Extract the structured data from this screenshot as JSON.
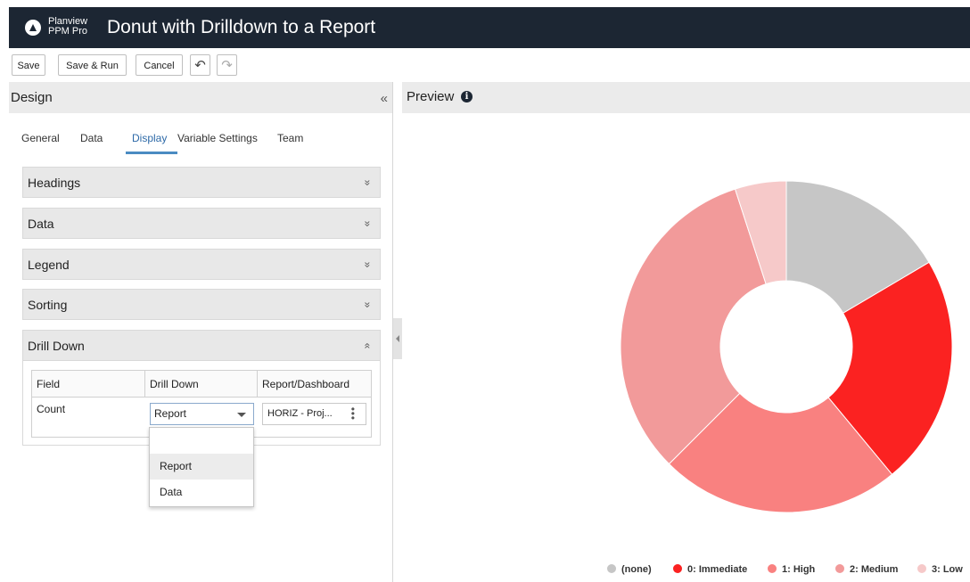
{
  "app": {
    "logo_line1": "Planview",
    "logo_line2": "PPM Pro",
    "title": "Donut with Drilldown to a Report"
  },
  "toolbar": {
    "save": "Save",
    "save_run": "Save & Run",
    "cancel": "Cancel",
    "undo_icon": "↶",
    "redo_icon": "↷"
  },
  "design": {
    "title": "Design",
    "collapse": "«",
    "tabs": [
      "General",
      "Data",
      "Display",
      "Variable Settings",
      "Team"
    ],
    "active_tab": "Display",
    "sections": [
      {
        "title": "Headings",
        "state": "collapsed"
      },
      {
        "title": "Data",
        "state": "collapsed"
      },
      {
        "title": "Legend",
        "state": "collapsed"
      },
      {
        "title": "Sorting",
        "state": "collapsed"
      },
      {
        "title": "Drill Down",
        "state": "expanded"
      }
    ],
    "chev_down": "»",
    "chev_up": "«",
    "drilldown": {
      "headers": [
        "Field",
        "Drill Down",
        "Report/Dashboard"
      ],
      "row": {
        "field": "Count",
        "drill": "Report",
        "report": "HORIZ - Proj..."
      },
      "options": [
        "Report",
        "Data"
      ]
    }
  },
  "preview": {
    "title": "Preview",
    "info": "i"
  },
  "chart_data": {
    "type": "pie",
    "donut": true,
    "categories": [
      "(none)",
      "0: Immediate",
      "1: High",
      "2: Medium",
      "3: Low"
    ],
    "values": [
      16.5,
      22.5,
      23.5,
      32.5,
      5.0
    ],
    "colors": [
      "#c6c6c6",
      "#fb2221",
      "#f98180",
      "#f29a9a",
      "#f6c9c9"
    ],
    "legend_position": "bottom"
  }
}
